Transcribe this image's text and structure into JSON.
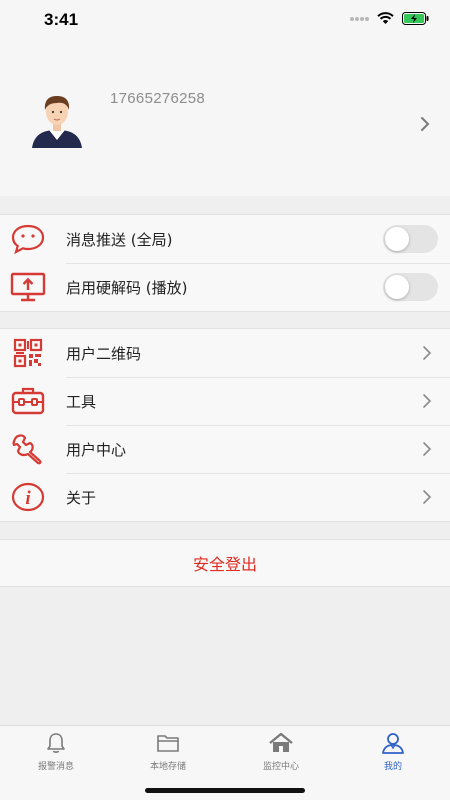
{
  "status_bar": {
    "time": "3:41",
    "icons": [
      "signal-icon",
      "wifi-icon",
      "battery-charging-icon"
    ]
  },
  "profile": {
    "phone": "17665276258",
    "avatar": "avatar-icon"
  },
  "settings_group_1": [
    {
      "label": "消息推送 (全局)",
      "icon": "message-icon",
      "toggle_on": false
    },
    {
      "label": "启用硬解码 (播放)",
      "icon": "monitor-upload-icon",
      "toggle_on": false
    }
  ],
  "settings_group_2": [
    {
      "label": "用户二维码",
      "icon": "qrcode-icon"
    },
    {
      "label": "工具",
      "icon": "toolbox-icon"
    },
    {
      "label": "用户中心",
      "icon": "wrench-icon"
    },
    {
      "label": "关于",
      "icon": "info-icon"
    }
  ],
  "logout_label": "安全登出",
  "tabbar": [
    {
      "label": "报警消息",
      "icon": "bell-icon",
      "active": false
    },
    {
      "label": "本地存储",
      "icon": "folder-icon",
      "active": false
    },
    {
      "label": "监控中心",
      "icon": "home-icon",
      "active": false
    },
    {
      "label": "我的",
      "icon": "user-icon",
      "active": true
    }
  ],
  "colors": {
    "accent_red": "#d63a34",
    "logout_red": "#e02b20",
    "tab_active": "#2f62c9",
    "tab_inactive": "#7a7a7a"
  }
}
